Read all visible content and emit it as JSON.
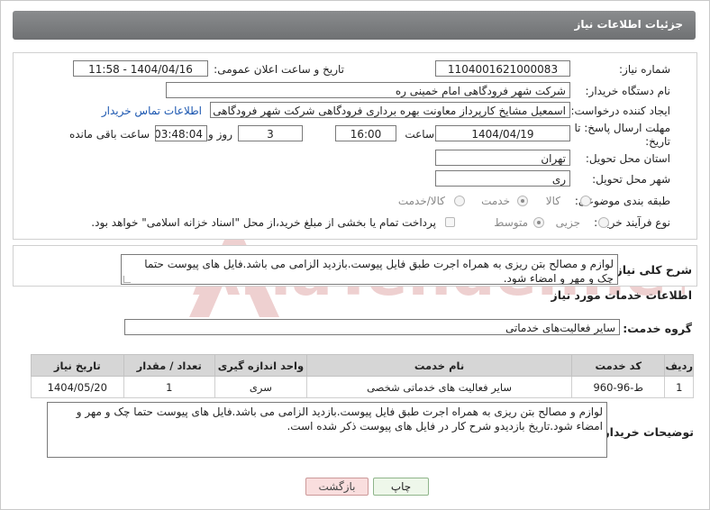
{
  "header": {
    "title": "جزئیات اطلاعات نیاز"
  },
  "form": {
    "need_number": {
      "label": "شماره نیاز:",
      "value": "1104001621000083"
    },
    "announce_datetime": {
      "label": "تاریخ و ساعت اعلان عمومی:",
      "value": "1404/04/16 - 11:58"
    },
    "buyer_org": {
      "label": "نام دستگاه خریدار:",
      "value": "شرکت شهر فرودگاهی امام خمینی  ره"
    },
    "requester": {
      "label": "ایجاد کننده درخواست:",
      "value": "اسمعیل مشایخ کارپرداز معاونت بهره برداری فرودگاهی شرکت شهر فرودگاهی ا",
      "contact_link": "اطلاعات تماس خریدار"
    },
    "deadline": {
      "label_line1": "مهلت ارسال پاسخ: تا",
      "label_line2": "تاریخ:",
      "date": "1404/04/19",
      "time_label": "ساعت",
      "time": "16:00",
      "days": "3",
      "days_label": "روز و",
      "remaining": "03:48:04",
      "remaining_label": "ساعت باقی مانده"
    },
    "province": {
      "label": "استان محل تحویل:",
      "value": "تهران"
    },
    "city": {
      "label": "شهر محل تحویل:",
      "value": "ری"
    },
    "category": {
      "label": "طبقه بندی موضوعی:",
      "options": [
        "کالا",
        "خدمت",
        "کالا/خدمت"
      ],
      "selected": "خدمت"
    },
    "process": {
      "label": "نوع فرآیند خرید :",
      "options": [
        "جزیی",
        "متوسط"
      ],
      "selected": "متوسط",
      "note": "پرداخت تمام یا بخشی از مبلغ خرید،از محل \"اسناد خزانه اسلامی\" خواهد بود."
    }
  },
  "description": {
    "label": "شرح کلی نیاز:",
    "text": "لوازم و مصالح بتن ریزی به همراه اجرت طبق فایل پیوست.بازدید الزامی می باشد.فایل های پیوست حتما چک و مهر و امضاء شود."
  },
  "services": {
    "section_title": "اطلاعات خدمات مورد نیاز",
    "group_label": "گروه خدمت:",
    "group_value": "سایر فعالیت‌های خدماتی",
    "columns": [
      "ردیف",
      "کد خدمت",
      "نام خدمت",
      "واحد اندازه گیری",
      "تعداد / مقدار",
      "تاریخ نیاز"
    ],
    "rows": [
      [
        "1",
        "ط-96-960",
        "سایر فعالیت های خدماتی شخصی",
        "سری",
        "1",
        "1404/05/20"
      ]
    ]
  },
  "buyer_notes": {
    "label": "توضیحات خریدار:",
    "text": "لوازم و مصالح بتن ریزی به همراه اجرت طبق فایل پیوست.بازدید الزامی می باشد.فایل های پیوست حتما چک و مهر و امضاء شود.تاریخ بازدیدو شرح کار در فایل های پیوست ذکر شده است."
  },
  "buttons": {
    "print": "چاپ",
    "back": "بازگشت"
  },
  "watermark": {
    "text": "AriaTender.neT"
  },
  "colors": {
    "header_bg": "#7b7d7f",
    "link": "#1a56b0",
    "back_btn_bg": "#f9dede",
    "print_btn_bg": "#eef7ea",
    "watermark": "#d9a3a3"
  }
}
